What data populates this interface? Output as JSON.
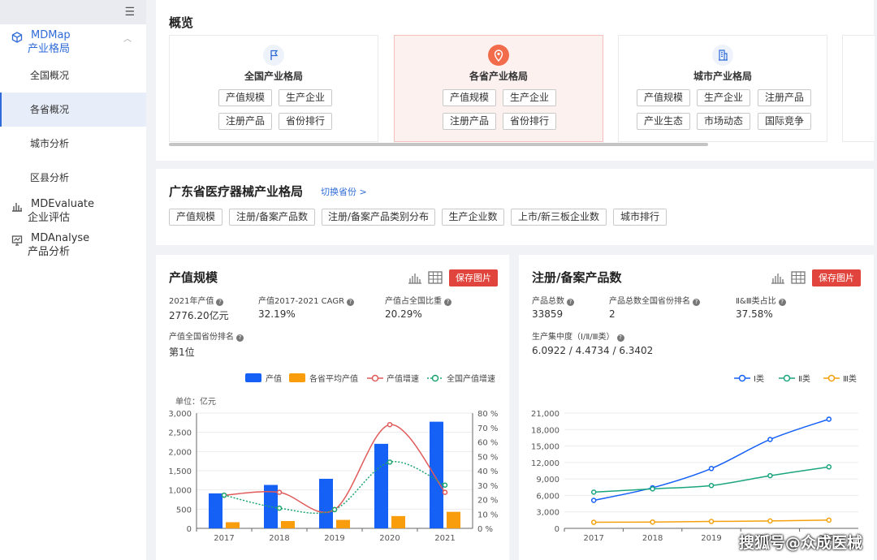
{
  "sidebar": {
    "menu_icon": "hamburger-icon",
    "groups": [
      {
        "title": "MDMap",
        "subtitle": "产业格局",
        "icon": "cube-icon"
      },
      {
        "title": "MDEvaluate",
        "subtitle": "企业评估",
        "icon": "bar-chart-icon"
      },
      {
        "title": "MDAnalyse",
        "subtitle": "产品分析",
        "icon": "analysis-icon"
      }
    ],
    "items": [
      "全国概况",
      "各省概况",
      "城市分析",
      "区县分析"
    ],
    "selected_item": "各省概况"
  },
  "overview": {
    "title": "概览",
    "cards": [
      {
        "name": "全国产业格局",
        "icon": "flag-icon",
        "tags": [
          "产值规模",
          "生产企业",
          "注册产品",
          "省份排行"
        ]
      },
      {
        "name": "各省产业格局",
        "icon": "location-pin-icon",
        "tags": [
          "产值规模",
          "生产企业",
          "注册产品",
          "省份排行"
        ]
      },
      {
        "name": "城市产业格局",
        "icon": "building-icon",
        "tags": [
          "产值规模",
          "生产企业",
          "注册产品",
          "产业生态",
          "市场动态",
          "国际竞争"
        ]
      }
    ]
  },
  "province": {
    "title": "广东省医疗器械产业格局",
    "switch_label": "切换省份 >",
    "tabs": [
      "产值规模",
      "注册/备案产品数",
      "注册/备案产品类别分布",
      "生产企业数",
      "上市/新三板企业数",
      "城市排行"
    ]
  },
  "panel1": {
    "title": "产值规模",
    "save_label": "保存图片",
    "metrics": [
      {
        "label": "2021年产值",
        "value": "2776.20亿元"
      },
      {
        "label": "产值2017-2021 CAGR",
        "value": "32.19%"
      },
      {
        "label": "产值占全国比重",
        "value": "20.29%"
      },
      {
        "label": "产值全国省份排名",
        "value": "第1位"
      }
    ],
    "unit_label": "单位：亿元"
  },
  "panel2": {
    "title": "注册/备案产品数",
    "save_label": "保存图片",
    "metrics": [
      {
        "label": "产品总数",
        "value": "33859"
      },
      {
        "label": "产品总数全国省份排名",
        "value": "2"
      },
      {
        "label": "Ⅱ&Ⅲ类占比",
        "value": "37.58%"
      },
      {
        "label": "生产集中度（Ⅰ/Ⅱ/Ⅲ类）",
        "value": "6.0922 / 4.4734 / 6.3402"
      }
    ]
  },
  "chart_data": [
    {
      "type": "bar",
      "categories": [
        "2017",
        "2018",
        "2019",
        "2020",
        "2021"
      ],
      "series": [
        {
          "name": "产值",
          "kind": "bar",
          "axis": "left",
          "color": "#1560f5",
          "values": [
            910,
            1130,
            1290,
            2200,
            2776
          ]
        },
        {
          "name": "各省平均产值",
          "kind": "bar",
          "axis": "left",
          "color": "#fa9d0d",
          "values": [
            160,
            190,
            220,
            320,
            430
          ]
        },
        {
          "name": "产值增速",
          "kind": "line",
          "axis": "right",
          "color": "#e05a5a",
          "values": [
            23,
            25,
            13,
            72,
            25
          ]
        },
        {
          "name": "全国产值增速",
          "kind": "line-dotted",
          "axis": "right",
          "color": "#1aa56f",
          "values": [
            23,
            14,
            13,
            46,
            30
          ]
        }
      ],
      "ylim": [
        0,
        3000
      ],
      "yticks": [
        "0",
        "500",
        "1,000",
        "1,500",
        "2,000",
        "2,500",
        "3,000"
      ],
      "y2lim": [
        0,
        80
      ],
      "y2ticks": [
        "0 %",
        "10 %",
        "20 %",
        "30 %",
        "40 %",
        "50 %",
        "60 %",
        "70 %",
        "80 %"
      ],
      "legend_position": "top-right"
    },
    {
      "type": "line",
      "categories": [
        "2017",
        "2018",
        "2019",
        "2020",
        "2021"
      ],
      "series": [
        {
          "name": "Ⅰ类",
          "color": "#1560f5",
          "values": [
            5100,
            7400,
            10900,
            16200,
            19900
          ]
        },
        {
          "name": "Ⅱ类",
          "color": "#1aa57f",
          "values": [
            6600,
            7200,
            7800,
            9600,
            11200
          ]
        },
        {
          "name": "Ⅲ类",
          "color": "#f5a10d",
          "values": [
            1100,
            1150,
            1250,
            1350,
            1500
          ]
        }
      ],
      "ylim": [
        0,
        21000
      ],
      "yticks": [
        "0",
        "3,000",
        "6,000",
        "9,000",
        "12,000",
        "15,000",
        "18,000",
        "21,000"
      ],
      "legend_position": "top-right"
    }
  ],
  "watermark": "搜狐号@众成医械"
}
